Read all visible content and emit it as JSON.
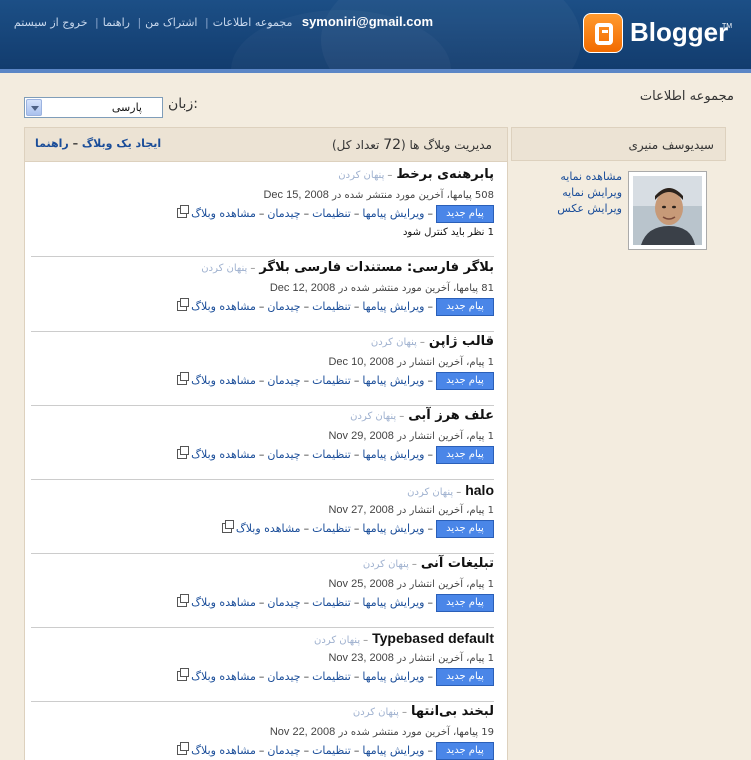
{
  "header": {
    "logo_text": "Blogger",
    "logo_tm": "TM",
    "email": "symoniri@gmail.com",
    "nav": [
      "مجموعه اطلاعات",
      "اشتراک من",
      "راهنما",
      "خروج از سیستم"
    ]
  },
  "page": {
    "title": "مجموعه اطلاعات",
    "language_label": "زبان:",
    "language_value": "پارسی"
  },
  "profile": {
    "name": "سیدیوسف منیری",
    "links": [
      "مشاهده نمایه",
      "ویرایش نمایه",
      "ویرایش عکس"
    ]
  },
  "blogs_panel": {
    "title_prefix": "مدیریت وبلاگ ها (",
    "count": "72",
    "title_suffix": " تعداد کل)",
    "create_link": "ایجاد یک وبلاگ",
    "help_link": "راهنما"
  },
  "labels": {
    "hide": "پنهان کردن",
    "new_post": "پیام جدید",
    "edit_posts": "ویرایش پیامها",
    "settings": "تنظیمات",
    "layout": "چیدمان",
    "view_blog": "مشاهده وبلاگ"
  },
  "blogs": [
    {
      "name": "پابرهنه‌ی برخط",
      "stats": "508 پیامها، آخرین مورد منتشر شده در ",
      "date": "Dec 15, 2008",
      "note": "1 نظر باید کنترل شود"
    },
    {
      "name": "بلاگر فارسی: مستندات فارسی بلاگر",
      "stats": "81 پیامها، آخرین مورد منتشر شده در ",
      "date": "Dec 12, 2008"
    },
    {
      "name": "قالب ژاپن",
      "stats": "1 پیام، آخرین انتشار در ",
      "date": "Dec 10, 2008"
    },
    {
      "name": "علف هرز آبی",
      "stats": "1 پیام، آخرین انتشار در ",
      "date": "Nov 29, 2008"
    },
    {
      "name": "halo",
      "stats": "1 پیام، آخرین انتشار در ",
      "date": "Nov 27, 2008",
      "short": true
    },
    {
      "name": "تبلیغات آنی",
      "stats": "1 پیام، آخرین انتشار در ",
      "date": "Nov 25, 2008"
    },
    {
      "name": "Typebased default",
      "stats": "1 پیام، آخرین انتشار در ",
      "date": "Nov 23, 2008"
    },
    {
      "name": "لبخند بی‌انتها",
      "stats": "19 پیامها، آخرین مورد منتشر شده در ",
      "date": "Nov 22, 2008"
    }
  ],
  "colors": {
    "header": "#1c4f86",
    "accent": "#4a86e8",
    "link": "#1a4d99",
    "background": "#f3ecdf"
  }
}
